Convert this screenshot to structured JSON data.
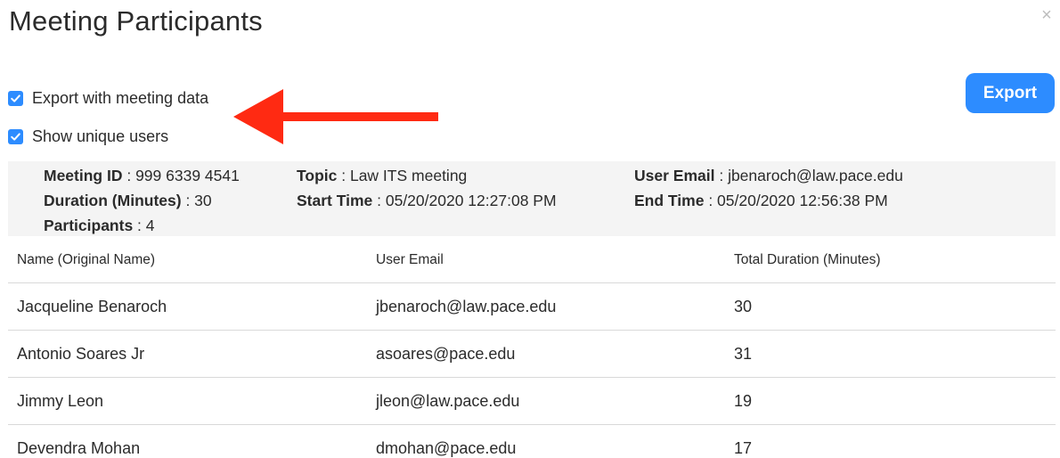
{
  "dialog": {
    "title": "Meeting Participants",
    "close_glyph": "×",
    "export_label": "Export"
  },
  "options": [
    {
      "label": "Export with meeting data",
      "checked": true
    },
    {
      "label": "Show unique users",
      "checked": true
    }
  ],
  "annotation": {
    "arrow_color": "#ff2a12"
  },
  "colors": {
    "accent": "#2d8cff",
    "meta_bg": "#f4f4f4"
  },
  "meeting": {
    "id_label": "Meeting ID",
    "id": "999 6339 4541",
    "duration_label": "Duration (Minutes)",
    "duration": "30",
    "participants_label": "Participants",
    "participants": "4",
    "topic_label": "Topic",
    "topic": "Law ITS meeting",
    "start_label": "Start Time",
    "start": "05/20/2020 12:27:08 PM",
    "email_label": "User Email",
    "email": "jbenaroch@law.pace.edu",
    "end_label": "End Time",
    "end": "05/20/2020 12:56:38 PM"
  },
  "table": {
    "headers": [
      "Name (Original Name)",
      "User Email",
      "Total Duration (Minutes)"
    ],
    "rows": [
      [
        "Jacqueline Benaroch",
        "jbenaroch@law.pace.edu",
        "30"
      ],
      [
        "Antonio Soares Jr",
        "asoares@pace.edu",
        "31"
      ],
      [
        "Jimmy Leon",
        "jleon@law.pace.edu",
        "19"
      ],
      [
        "Devendra Mohan",
        "dmohan@pace.edu",
        "17"
      ]
    ]
  }
}
